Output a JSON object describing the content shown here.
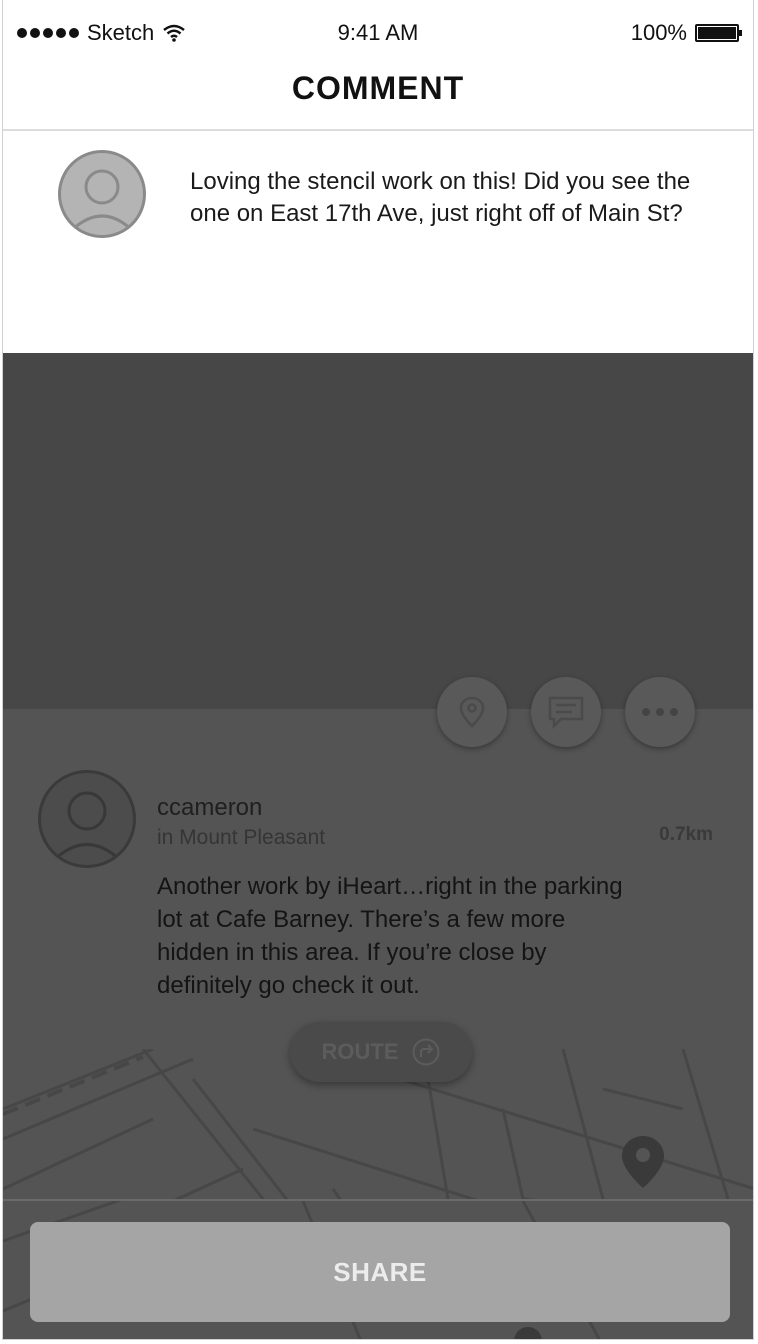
{
  "status_bar": {
    "carrier": "Sketch",
    "time": "9:41 AM",
    "battery": "100%",
    "icons": [
      "signal-dots-icon",
      "wifi-icon",
      "battery-icon"
    ]
  },
  "header": {
    "title": "COMMENT"
  },
  "comment": {
    "text": "Loving the stencil work on this! Did you see the one on East 17th Ave, just right off of Main St?"
  },
  "post": {
    "username": "ccameron",
    "location": "in Mount Pleasant",
    "distance": "0.7km",
    "text": "Another work by iHeart…right in the parking lot at Cafe Barney. There’s a few more hidden in this area. If you’re close by definitely go check it out.",
    "actions": [
      "location-pin-icon",
      "comment-icon",
      "more-dots-icon"
    ],
    "route_label": "ROUTE"
  },
  "footer": {
    "share_label": "SHARE"
  },
  "colors": {
    "overlay_dark": "#474747",
    "card": "#545454",
    "share_button": "#a5a5a5"
  }
}
